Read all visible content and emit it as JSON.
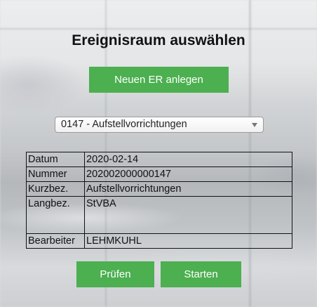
{
  "page": {
    "title": "Ereignisraum auswählen"
  },
  "buttons": {
    "new_label": "Neuen ER anlegen",
    "check_label": "Prüfen",
    "start_label": "Starten"
  },
  "select": {
    "selected": "0147 - Aufstellvorrichtungen"
  },
  "details": {
    "rows": [
      {
        "label": "Datum",
        "value": "2020-02-14"
      },
      {
        "label": "Nummer",
        "value": "202002000000147"
      },
      {
        "label": "Kurzbez.",
        "value": "Aufstellvorrichtungen"
      },
      {
        "label": "Langbez.",
        "value": "StVBA"
      },
      {
        "label": "Bearbeiter",
        "value": "LEHMKUHL"
      }
    ]
  },
  "colors": {
    "button_green": "#4caf50"
  },
  "icons": {
    "dropdown": "chevron-down-icon"
  }
}
